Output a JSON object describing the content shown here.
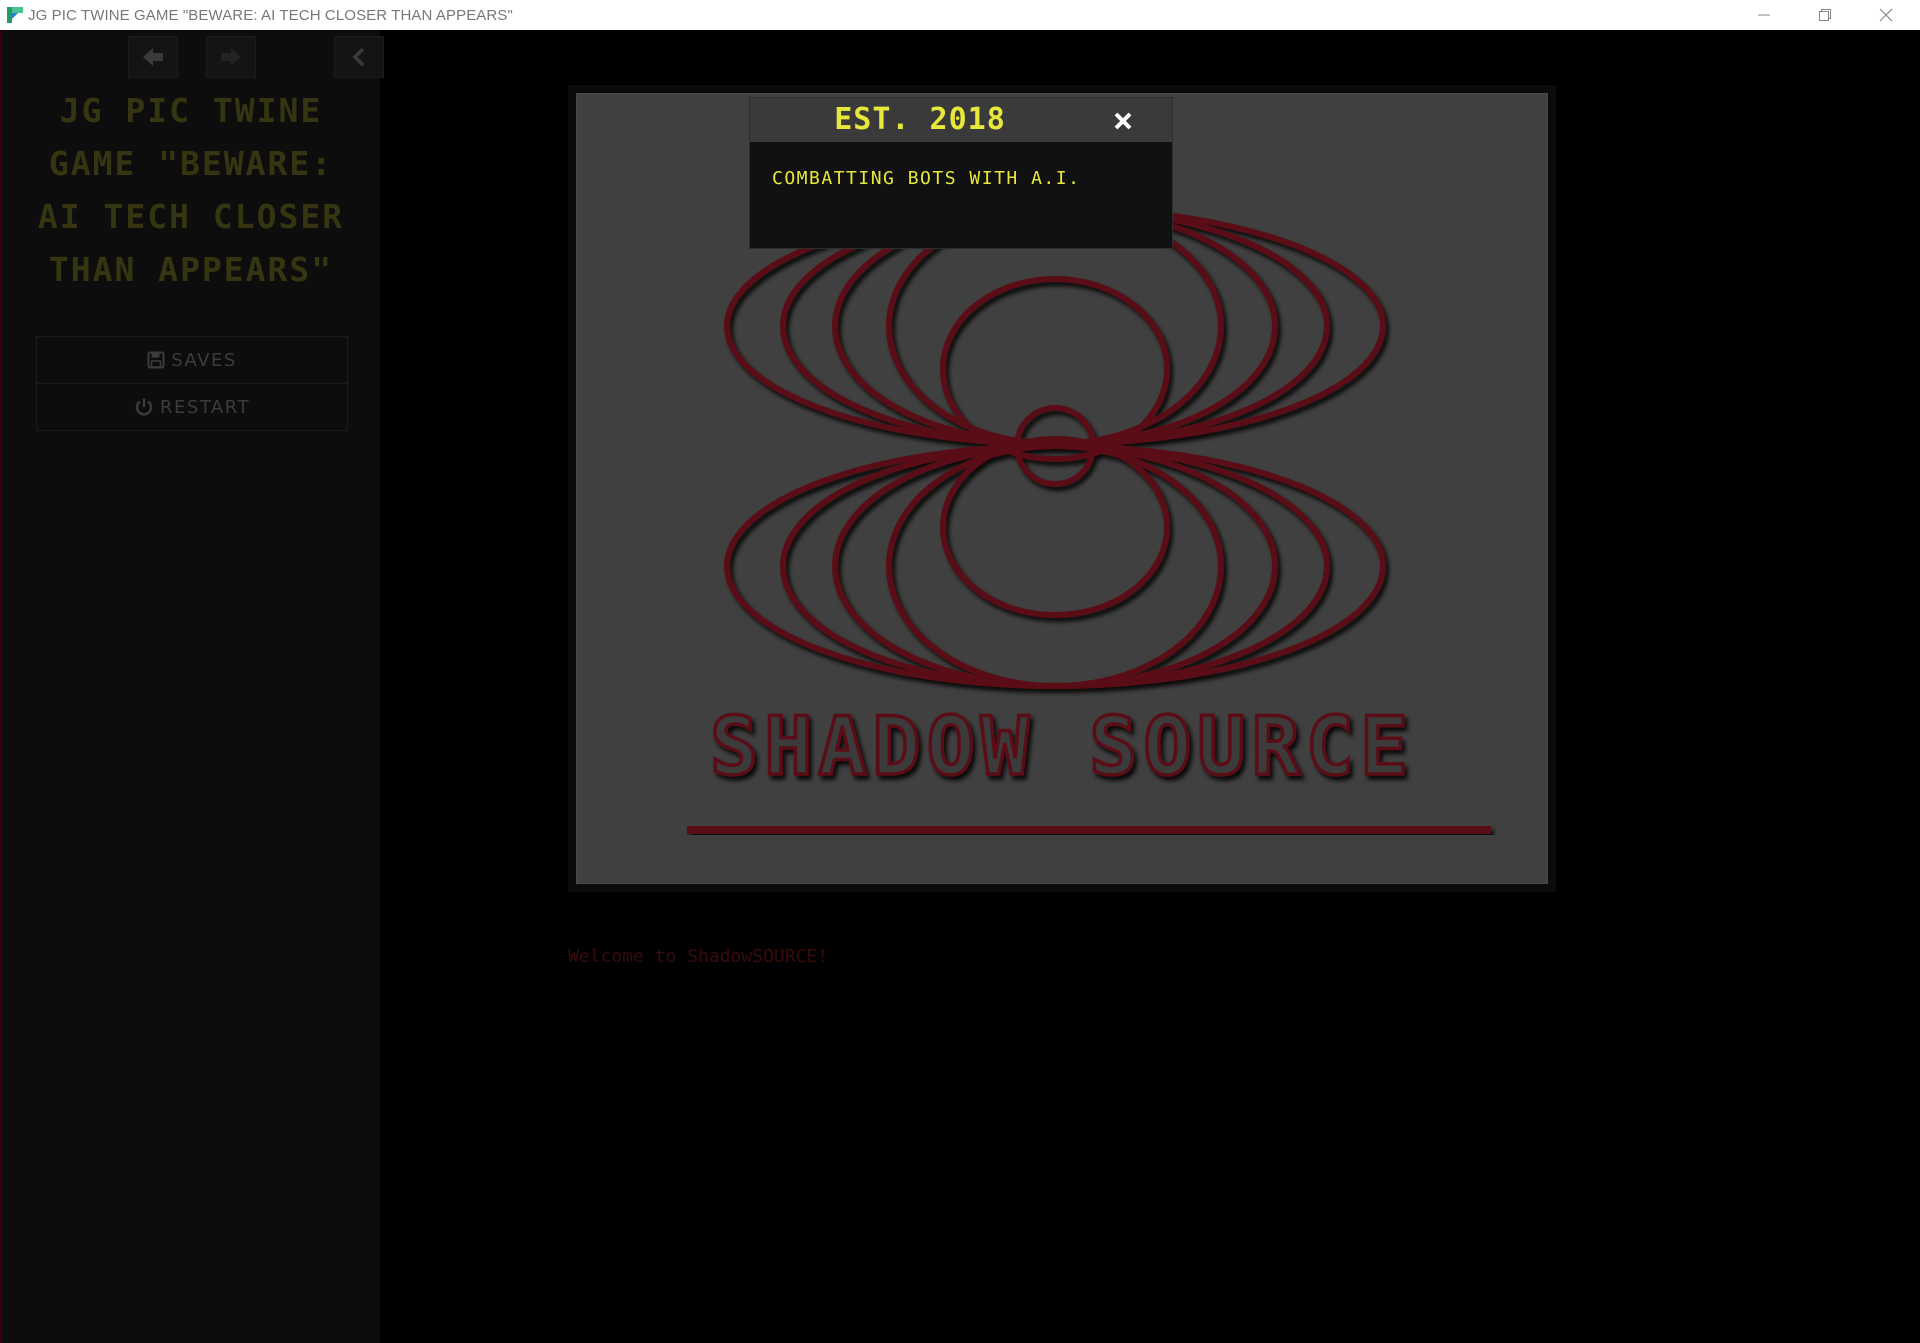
{
  "window": {
    "title": "JG PIC TWINE GAME \"BEWARE: AI TECH CLOSER THAN APPEARS\"",
    "controls": [
      "minimize",
      "restore",
      "close"
    ]
  },
  "sidebar": {
    "nav": {
      "back_icon": "arrow-left-icon",
      "forward_icon": "arrow-right-icon",
      "toggle_icon": "chevron-left-icon"
    },
    "story_title": "JG PIC TWINE GAME \"BEWARE: AI TECH CLOSER THAN APPEARS\"",
    "menu": [
      {
        "label": "SAVES",
        "icon": "floppy-disk-icon"
      },
      {
        "label": "RESTART",
        "icon": "power-icon"
      }
    ]
  },
  "passage": {
    "logo_text": "SHADOW SOURCE",
    "welcome_text": "Welcome to ShadowSOURCE!"
  },
  "dialog": {
    "title": "EST. 2018",
    "body": "COMBATTING BOTS WITH A.I."
  },
  "colors": {
    "accent_yellow": "#e8e83a",
    "logo_red": "#5a0e12",
    "sidebar_bg": "#0d0d0d"
  }
}
